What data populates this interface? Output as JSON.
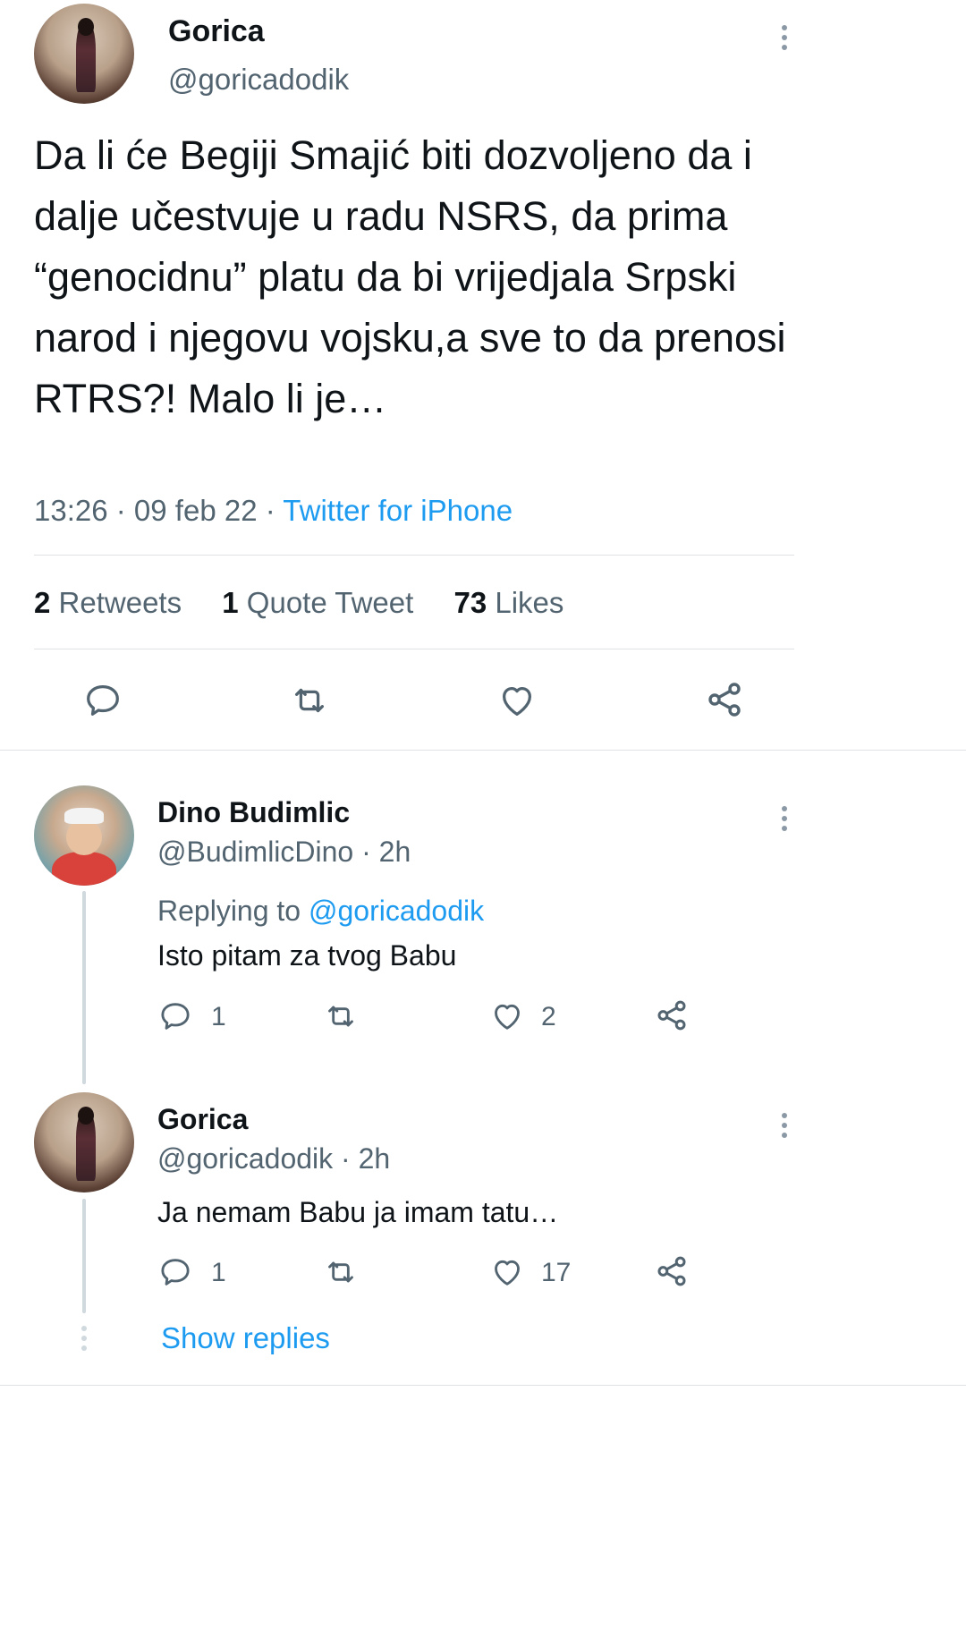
{
  "tweet": {
    "author_name": "Gorica",
    "author_handle": "@goricadodik",
    "text": "Da li će Begiji Smajić biti dozvoljeno da i dalje učestvuje u radu NSRS, da prima “genocidnu” platu da bi vrijedjala Srpski narod i njegovu vojsku,a sve to da prenosi RTRS?! Malo li je…",
    "time": "13:26",
    "date": "09 feb 22",
    "source": "Twitter for iPhone",
    "retweets_count": "2",
    "retweets_label": "Retweets",
    "quotes_count": "1",
    "quotes_label": "Quote Tweet",
    "likes_count": "73",
    "likes_label": "Likes"
  },
  "replies": [
    {
      "author_name": "Dino Budimlic",
      "author_handle": "@BudimlicDino · 2h",
      "replying_prefix": "Replying to",
      "replying_to": "@goricadodik",
      "text": "Isto pitam za tvog Babu",
      "reply_count": "1",
      "retweet_count": "",
      "like_count": "2"
    },
    {
      "author_name": "Gorica",
      "author_handle": "@goricadodik · 2h",
      "text": "Ja nemam Babu ja imam tatu…",
      "reply_count": "1",
      "retweet_count": "",
      "like_count": "17"
    }
  ],
  "show_replies_label": "Show replies",
  "icons": {
    "reply": "reply-icon",
    "retweet": "retweet-icon",
    "like": "heart-icon",
    "share": "share-icon",
    "more": "more-vertical-icon"
  },
  "colors": {
    "accent": "#1d9bf0",
    "muted": "#536471",
    "text": "#0f1419",
    "divider": "#dfe3e6"
  }
}
